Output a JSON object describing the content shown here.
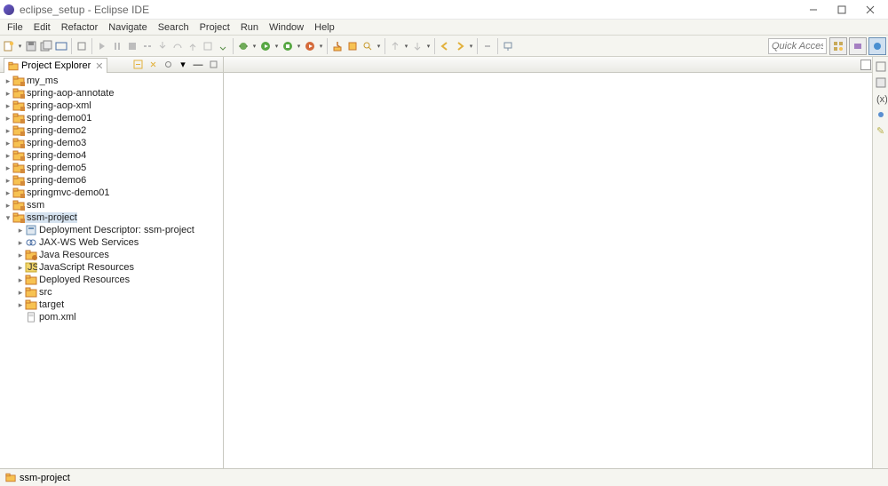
{
  "window": {
    "title": "eclipse_setup - Eclipse IDE"
  },
  "menu": [
    "File",
    "Edit",
    "Refactor",
    "Navigate",
    "Search",
    "Project",
    "Run",
    "Window",
    "Help"
  ],
  "quick_access_placeholder": "Quick Access",
  "project_explorer": {
    "title": "Project Explorer",
    "projects": [
      {
        "name": "my_ms"
      },
      {
        "name": "spring-aop-annotate"
      },
      {
        "name": "spring-aop-xml"
      },
      {
        "name": "spring-demo01"
      },
      {
        "name": "spring-demo2"
      },
      {
        "name": "spring-demo3"
      },
      {
        "name": "spring-demo4"
      },
      {
        "name": "spring-demo5"
      },
      {
        "name": "spring-demo6"
      },
      {
        "name": "springmvc-demo01"
      },
      {
        "name": "ssm"
      }
    ],
    "selected_project": "ssm-project",
    "selected_children": [
      {
        "label": "Deployment Descriptor: ssm-project",
        "icon": "dd",
        "expandable": true
      },
      {
        "label": "JAX-WS Web Services",
        "icon": "ws",
        "expandable": true
      },
      {
        "label": "Java Resources",
        "icon": "java",
        "expandable": true
      },
      {
        "label": "JavaScript Resources",
        "icon": "js",
        "expandable": true
      },
      {
        "label": "Deployed Resources",
        "icon": "folder",
        "expandable": true
      },
      {
        "label": "src",
        "icon": "folder",
        "expandable": true
      },
      {
        "label": "target",
        "icon": "folder",
        "expandable": true
      },
      {
        "label": "pom.xml",
        "icon": "file",
        "expandable": false
      }
    ]
  },
  "status": {
    "label": "ssm-project"
  }
}
